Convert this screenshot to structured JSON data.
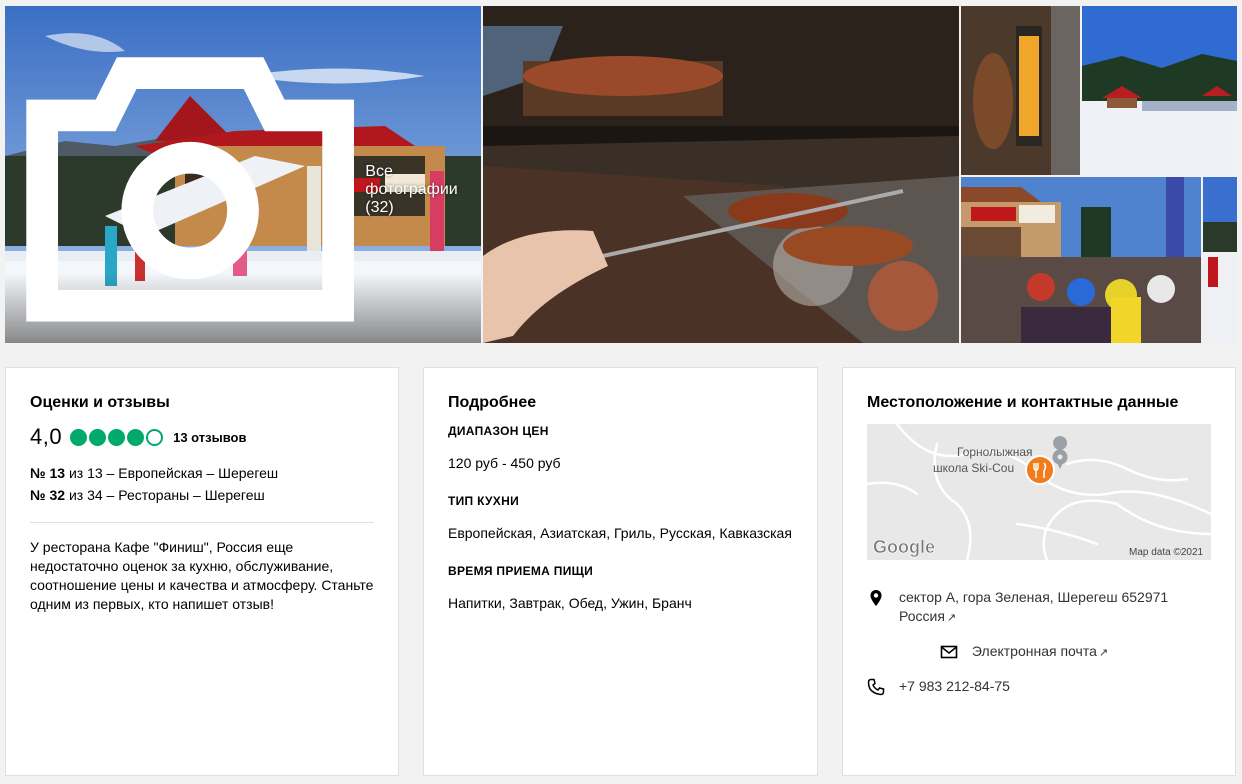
{
  "gallery": {
    "all_photos_label": "Все фотографии (32)"
  },
  "reviews": {
    "title": "Оценки и отзывы",
    "rating": "4,0",
    "rating_value": 4,
    "rating_max": 5,
    "review_count": "13 отзывов",
    "rankings": [
      {
        "rank": "№ 13",
        "text": " из 13 – Европейская – Шерегеш"
      },
      {
        "rank": "№ 32",
        "text": " из 34 – Рестораны – Шерегеш"
      }
    ],
    "description": "У ресторана Кафе \"Финиш\", Россия еще недостаточно оценок за кухню, обслуживание, соотношение цены и качества и атмосферу. Станьте одним из первых, кто напишет отзыв!",
    "accent_color": "#00aa6c"
  },
  "details": {
    "title": "Подробнее",
    "price_label": "ДИАПАЗОН ЦЕН",
    "price_value": "120 руб - 450 руб",
    "cuisine_label": "ТИП КУХНИ",
    "cuisine_value": "Европейская, Азиатская, Гриль, Русская, Кавказская",
    "meals_label": "ВРЕМЯ ПРИЕМА ПИЩИ",
    "meals_value": "Напитки, Завтрак, Обед, Ужин, Бранч"
  },
  "location": {
    "title": "Местоположение и контактные данные",
    "map": {
      "place_label_line1": "Горнолыжная",
      "place_label_line2": "школа Ski-Cou",
      "google_logo": "Google",
      "attribution": "Map data ©2021"
    },
    "address_line1": "сектор А, гора Зеленая, Шерегеш 652971",
    "address_line2": "Россия",
    "email_label": "Электронная почта",
    "phone": "+7 983 212-84-75"
  },
  "icons": {
    "camera": "camera-icon",
    "location": "location-pin-icon",
    "email": "envelope-icon",
    "phone": "phone-icon",
    "external": "external-link-icon"
  }
}
